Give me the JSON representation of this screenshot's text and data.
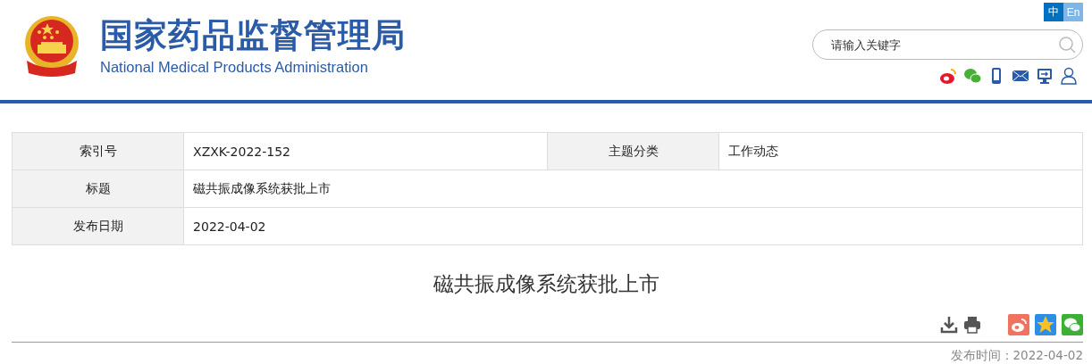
{
  "header": {
    "title_cn": "国家药品监督管理局",
    "title_en": "National Medical Products Administration",
    "languages": [
      {
        "label": "中",
        "selected": true
      },
      {
        "label": "En",
        "selected": false
      }
    ],
    "search": {
      "placeholder": "请输入关键字"
    }
  },
  "info_table": {
    "rows": [
      [
        {
          "label": "索引号",
          "value": "XZXK-2022-152"
        },
        {
          "label": "主题分类",
          "value": "工作动态"
        }
      ],
      [
        {
          "label": "标题",
          "value": "磁共振成像系统获批上市"
        }
      ],
      [
        {
          "label": "发布日期",
          "value": "2022-04-02"
        }
      ]
    ]
  },
  "article": {
    "title": "磁共振成像系统获批上市",
    "published": "发布时间：2022-04-02"
  }
}
